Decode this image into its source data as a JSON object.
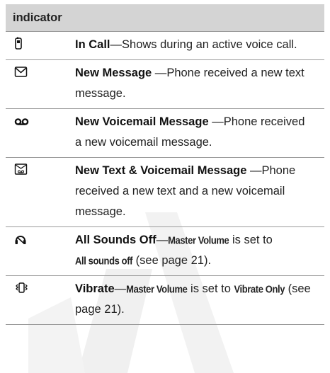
{
  "table": {
    "header": "indicator",
    "rows": [
      {
        "icon": "phone-in-call-icon",
        "term": "In Call",
        "dash": "—",
        "text": "Shows during an active voice call."
      },
      {
        "icon": "envelope-icon",
        "term": "New Message",
        "dash": " —",
        "text": "Phone received a new text message."
      },
      {
        "icon": "voicemail-icon",
        "term": "New Voicemail Message",
        "dash": " —",
        "text": "Phone received a new voicemail message."
      },
      {
        "icon": "text-and-voicemail-icon",
        "term": "New Text & Voicemail Message",
        "dash": " —",
        "text": "Phone received a new text and a new voicemail message."
      },
      {
        "icon": "all-sounds-off-icon",
        "term": "All Sounds Off",
        "dash": "—",
        "text_a": "Master Volume",
        "text_b": " is set to ",
        "text_c": "All sounds off",
        "text_d": " (see page 21)."
      },
      {
        "icon": "vibrate-icon",
        "term": "Vibrate",
        "dash": "—",
        "text_a": "Master Volume",
        "text_b": " is set to ",
        "text_c": "Vibrate Only",
        "text_d": " (see page 21)."
      }
    ]
  },
  "colors": {
    "header_bg": "#d4d4d4",
    "rule": "#9a9a9a",
    "watermark": "#ececec"
  }
}
